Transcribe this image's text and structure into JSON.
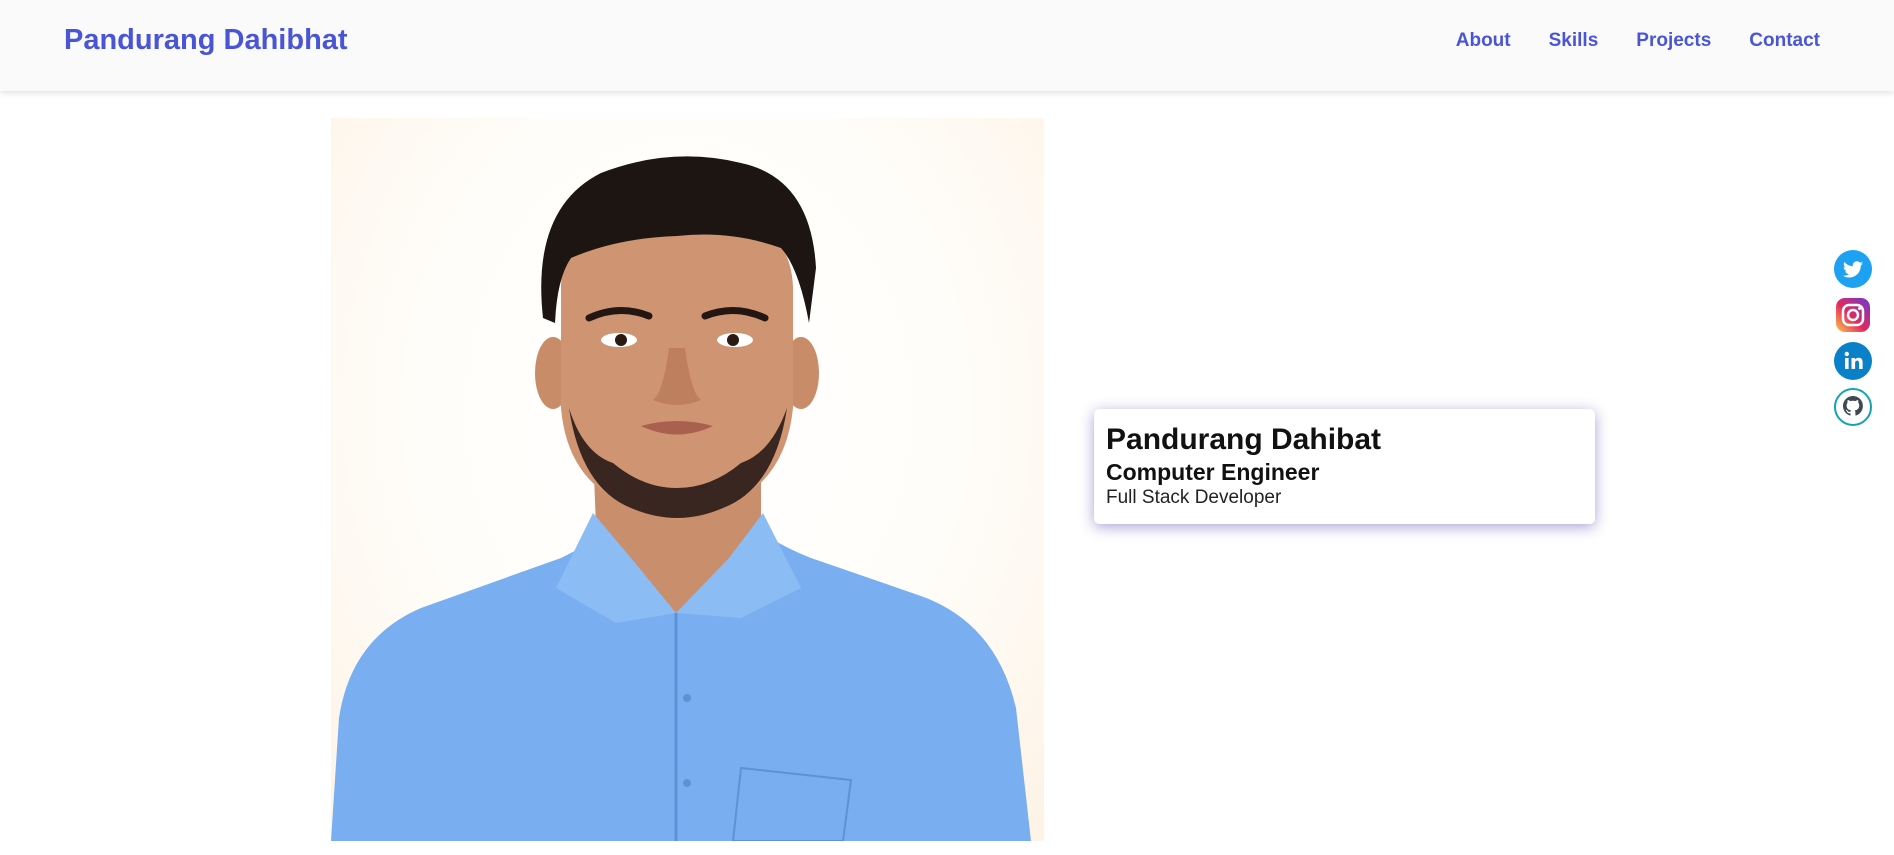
{
  "header": {
    "brand": "Pandurang Dahibhat",
    "nav": [
      "About",
      "Skills",
      "Projects",
      "Contact"
    ]
  },
  "hero": {
    "name": "Pandurang Dahibat",
    "role": "Computer Engineer",
    "subtitle": "Full Stack Developer"
  },
  "social": {
    "items": [
      "twitter-icon",
      "instagram-icon",
      "linkedin-icon",
      "github-icon"
    ]
  },
  "colors": {
    "accent": "#4a55d6",
    "header_bg": "#fafafa",
    "shirt": "#7ab0f0",
    "twitter": "#1da1f2",
    "linkedin": "#0a80c8"
  }
}
